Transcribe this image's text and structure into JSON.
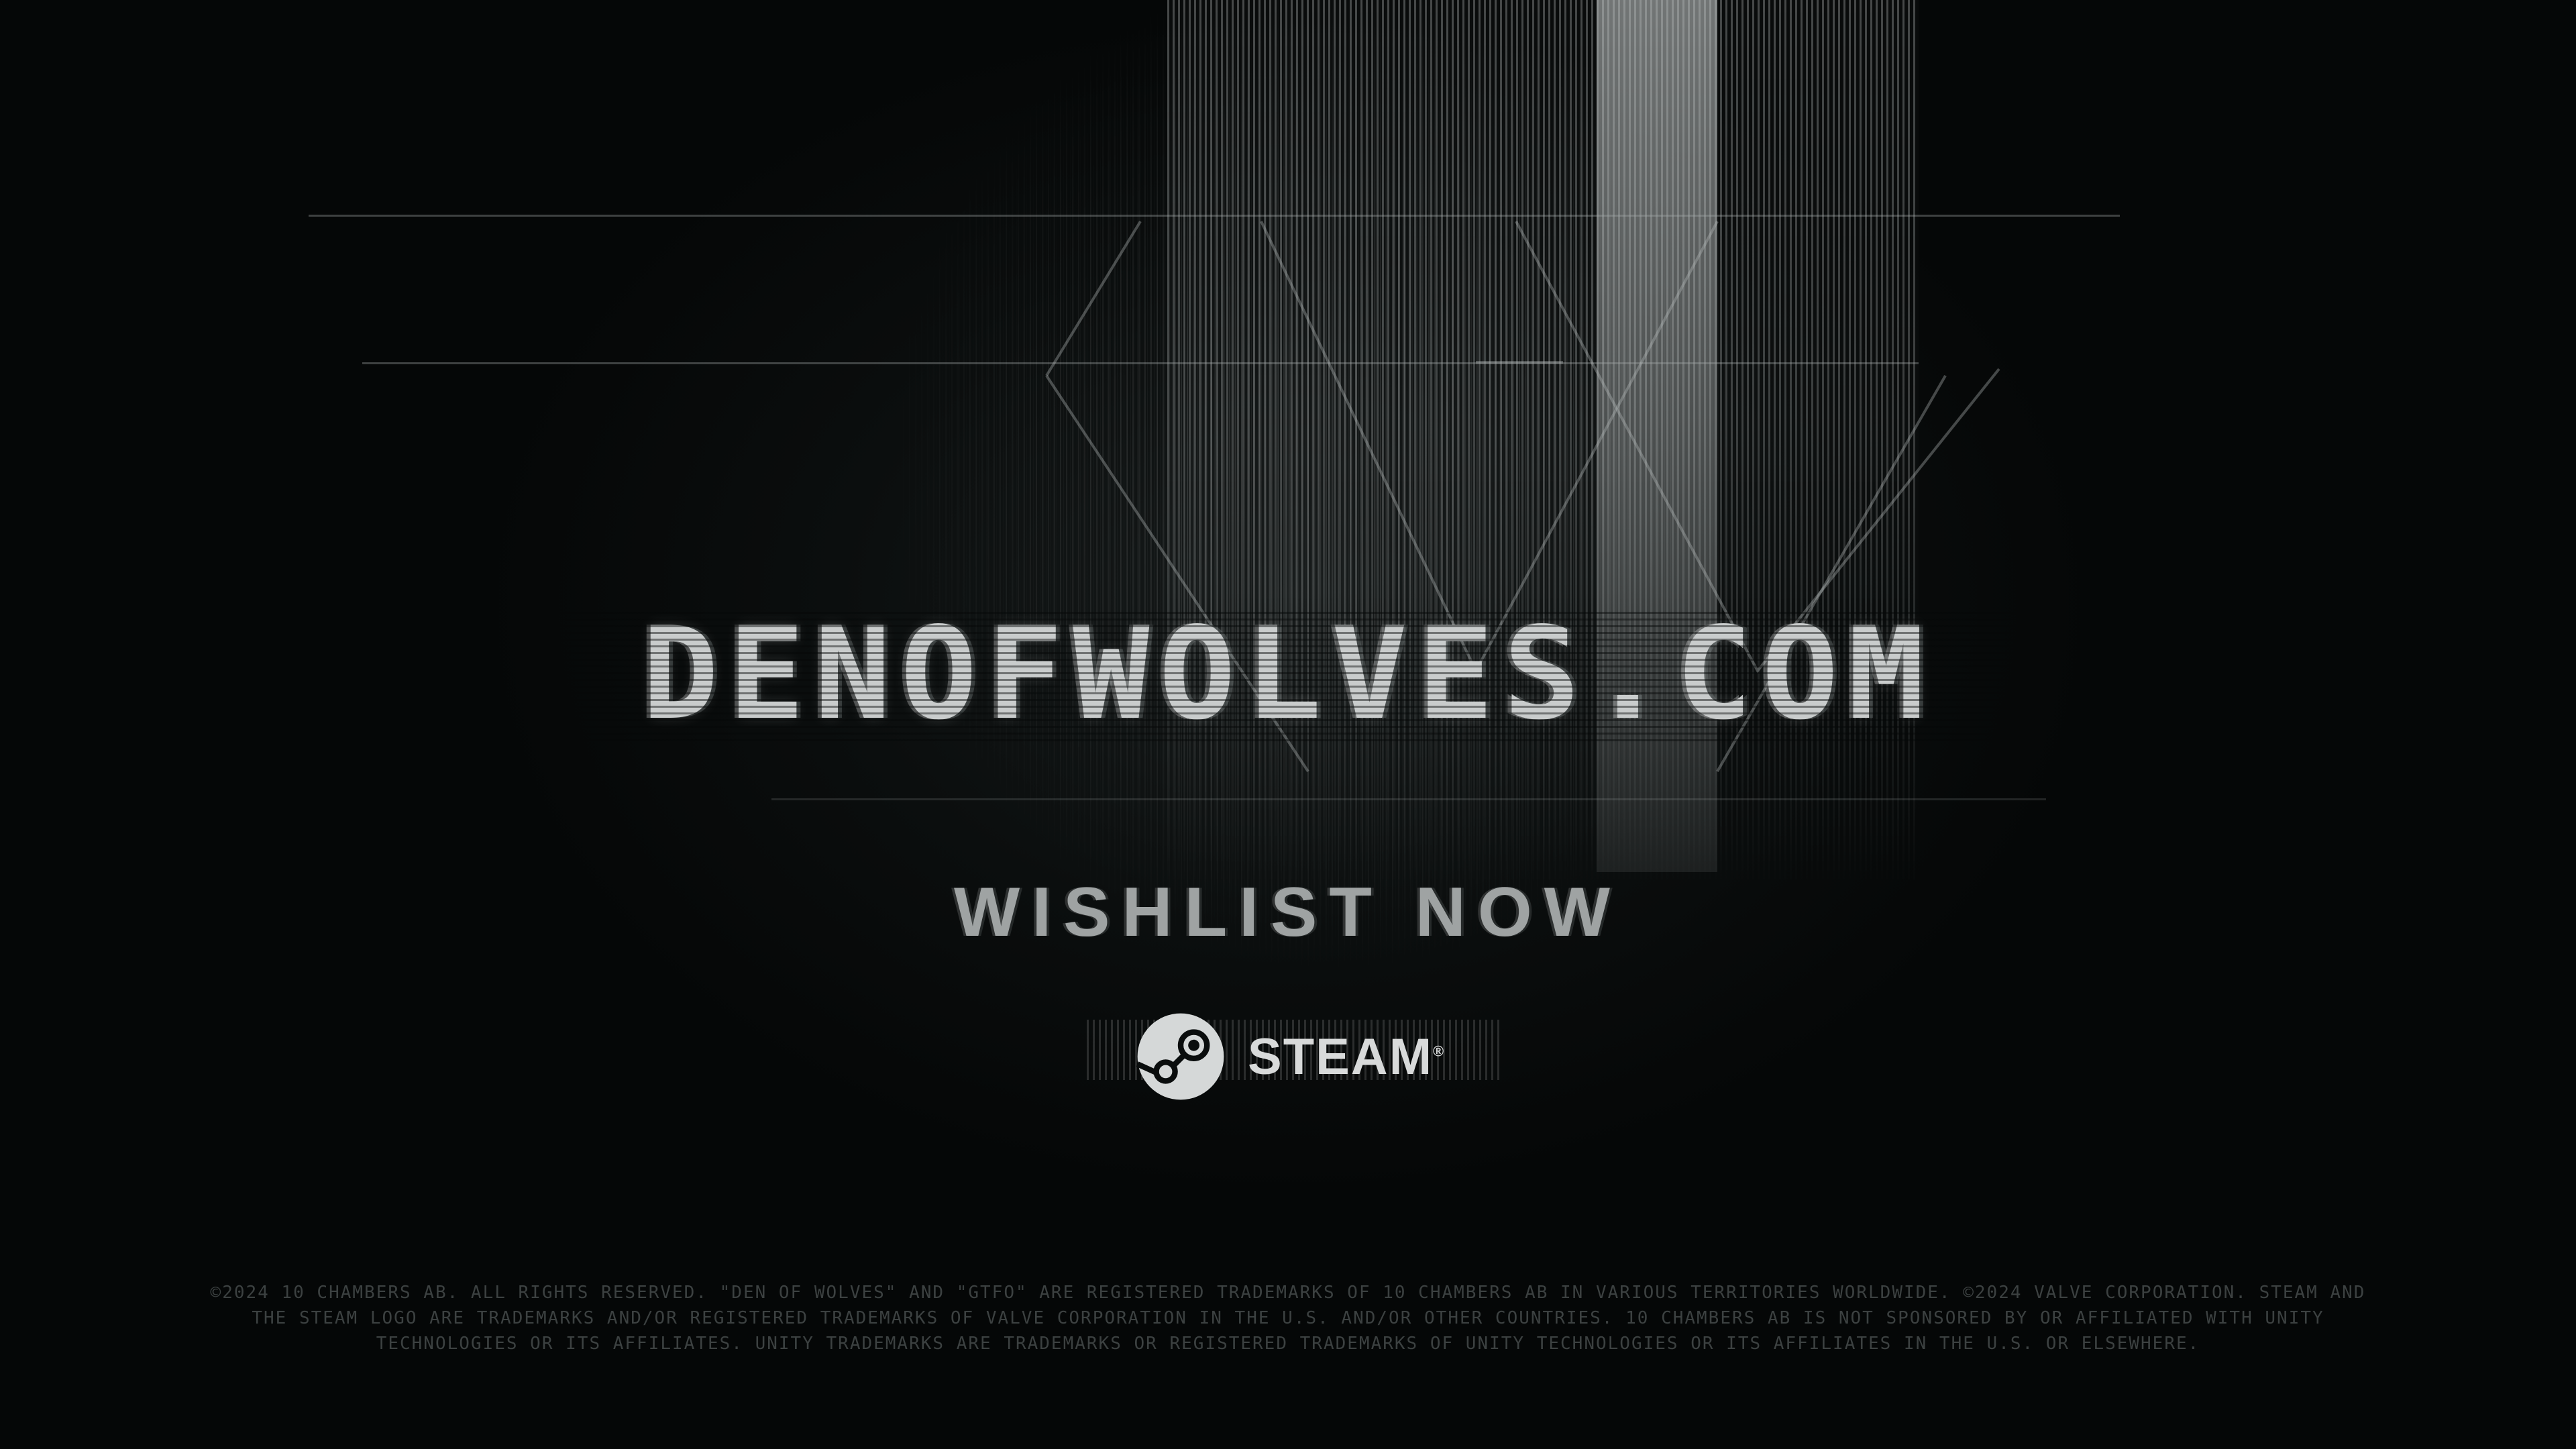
{
  "screen": {
    "title": "DENOFWOLVES.COM",
    "call_to_action": "WISHLIST NOW",
    "platform_logo": {
      "icon": "steam-icon",
      "label": "STEAM",
      "trademark": "®"
    },
    "legal_lines": [
      "©2024 10 CHAMBERS AB. ALL RIGHTS RESERVED. \"DEN OF WOLVES\" AND \"GTFO\" ARE REGISTERED TRADEMARKS OF 10 CHAMBERS AB IN VARIOUS TERRITORIES WORLDWIDE. ©2024 VALVE CORPORATION. STEAM AND",
      "THE STEAM LOGO ARE TRADEMARKS AND/OR REGISTERED TRADEMARKS OF VALVE CORPORATION IN THE U.S. AND/OR OTHER COUNTRIES. 10 CHAMBERS AB IS NOT SPONSORED BY OR AFFILIATED WITH UNITY",
      "TECHNOLOGIES OR ITS AFFILIATES. UNITY TRADEMARKS ARE TRADEMARKS OR REGISTERED TRADEMARKS OF UNITY TECHNOLOGIES OR ITS AFFILIATES IN THE U.S. OR ELSEWHERE."
    ]
  },
  "colors": {
    "background": "#050707",
    "title": "#c9cccc",
    "cta": "#9fa3a3",
    "legal": "#3c4141"
  }
}
